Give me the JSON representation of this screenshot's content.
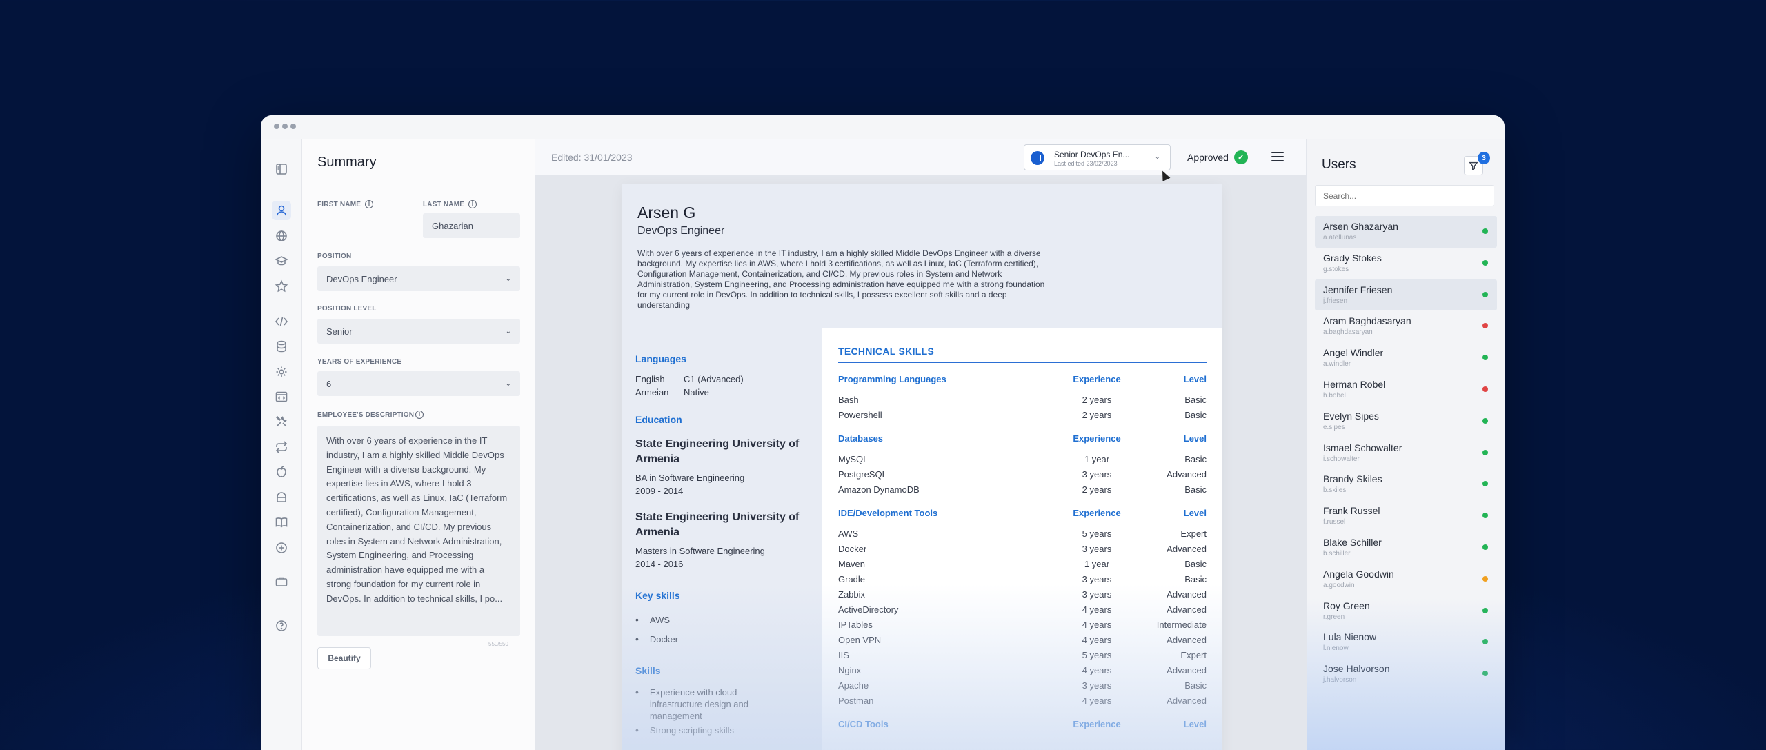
{
  "form": {
    "title": "Summary",
    "first_name_label": "FIRST NAME",
    "first_name_value": "",
    "last_name_label": "LAST NAME",
    "last_name_value": "Ghazarian",
    "position_label": "POSITION",
    "position_value": "DevOps Engineer",
    "level_label": "POSITION LEVEL",
    "level_value": "Senior",
    "years_label": "YEARS OF EXPERIENCE",
    "years_value": "6",
    "desc_label": "EMPLOYEE'S DESCRIPTION",
    "desc_value": "With over 6 years of experience in the IT industry, I am a highly skilled Middle DevOps Engineer with a diverse background. My expertise lies in AWS, where I hold 3 certifications, as well as Linux, IaC (Terraform certified), Configuration Management, Containerization, and CI/CD. My previous roles in System and Network Administration, System Engineering, and Processing administration have equipped me with a strong foundation for my current role in DevOps. In addition to technical skills, I po...",
    "char_count": "550/550",
    "beautify_label": "Beautify"
  },
  "toolbar": {
    "edited": "Edited: 31/01/2023",
    "template_title": "Senior DevOps En...",
    "template_sub": "Last edited 23/02/2023",
    "status": "Approved"
  },
  "cv": {
    "name": "Arsen G",
    "role": "DevOps Engineer",
    "summary": "With over 6 years of experience in the IT industry, I am a highly skilled Middle DevOps Engineer with a diverse background. My expertise lies in AWS, where I hold 3 certifications, as well as Linux, IaC (Terraform certified), Configuration Management, Containerization, and CI/CD. My previous roles in System and Network Administration, System Engineering, and Processing administration have equipped me with a strong foundation for my current role in DevOps. In addition to technical skills, I possess excellent soft skills and a deep understanding",
    "languages_title": "Languages",
    "languages": [
      {
        "name": "English",
        "level": "C1 (Advanced)"
      },
      {
        "name": "Armeian",
        "level": "Native"
      }
    ],
    "education_title": "Education",
    "education": [
      {
        "school": "State Engineering University of Armenia",
        "degree": "BA in Software Engineering",
        "years": "2009 - 2014"
      },
      {
        "school": "State Engineering University of Armenia",
        "degree": "Masters in Software Engineering",
        "years": "2014 - 2016"
      }
    ],
    "key_skills_title": "Key skills",
    "key_skills": [
      "AWS",
      "Docker"
    ],
    "skills_title": "Skills",
    "skills": [
      "Experience with cloud infrastructure design and management",
      "Strong scripting skills"
    ],
    "tech_title": "TECHNICAL SKILLS",
    "col_exp": "Experience",
    "col_level": "Level",
    "groups": [
      {
        "title": "Programming Languages",
        "rows": [
          {
            "name": "Bash",
            "exp": "2 years",
            "level": "Basic"
          },
          {
            "name": "Powershell",
            "exp": "2 years",
            "level": "Basic"
          }
        ]
      },
      {
        "title": "Databases",
        "rows": [
          {
            "name": "MySQL",
            "exp": "1 year",
            "level": "Basic"
          },
          {
            "name": "PostgreSQL",
            "exp": "3 years",
            "level": "Advanced"
          },
          {
            "name": "Amazon DynamoDB",
            "exp": "2 years",
            "level": "Basic"
          }
        ]
      },
      {
        "title": "IDE/Development Tools",
        "rows": [
          {
            "name": "AWS",
            "exp": "5 years",
            "level": "Expert"
          },
          {
            "name": "Docker",
            "exp": "3 years",
            "level": "Advanced"
          },
          {
            "name": "Maven",
            "exp": "1 year",
            "level": "Basic"
          },
          {
            "name": "Gradle",
            "exp": "3 years",
            "level": "Basic"
          },
          {
            "name": "Zabbix",
            "exp": "3 years",
            "level": "Advanced"
          },
          {
            "name": "ActiveDirectory",
            "exp": "4 years",
            "level": "Advanced"
          },
          {
            "name": "IPTables",
            "exp": "4 years",
            "level": "Intermediate"
          },
          {
            "name": "Open VPN",
            "exp": "4 years",
            "level": "Advanced"
          },
          {
            "name": "IIS",
            "exp": "5 years",
            "level": "Expert"
          },
          {
            "name": "Nginx",
            "exp": "4 years",
            "level": "Advanced"
          },
          {
            "name": "Apache",
            "exp": "3 years",
            "level": "Basic"
          },
          {
            "name": "Postman",
            "exp": "4 years",
            "level": "Advanced"
          }
        ]
      },
      {
        "title": "CI/CD Tools",
        "rows": []
      }
    ]
  },
  "users": {
    "title": "Users",
    "filter_count": "3",
    "search_placeholder": "Search...",
    "list": [
      {
        "name": "Arsen Ghazaryan",
        "login": "a.atellunas",
        "status": "#22b455"
      },
      {
        "name": "Grady Stokes",
        "login": "g.stokes",
        "status": "#22b455"
      },
      {
        "name": "Jennifer Friesen",
        "login": "j.friesen",
        "status": "#22b455"
      },
      {
        "name": "Aram Baghdasaryan",
        "login": "a.baghdasaryan",
        "status": "#e04444"
      },
      {
        "name": "Angel Windler",
        "login": "a.windler",
        "status": "#22b455"
      },
      {
        "name": "Herman Robel",
        "login": "h.bobel",
        "status": "#e04444"
      },
      {
        "name": "Evelyn Sipes",
        "login": "e.sipes",
        "status": "#22b455"
      },
      {
        "name": "Ismael Schowalter",
        "login": "i.schowalter",
        "status": "#22b455"
      },
      {
        "name": "Brandy Skiles",
        "login": "b.skiles",
        "status": "#22b455"
      },
      {
        "name": "Frank Russel",
        "login": "f.russel",
        "status": "#22b455"
      },
      {
        "name": "Blake Schiller",
        "login": "b.schiller",
        "status": "#22b455"
      },
      {
        "name": "Angela Goodwin",
        "login": "a.goodwin",
        "status": "#f0a020"
      },
      {
        "name": "Roy Green",
        "login": "r.green",
        "status": "#22b455"
      },
      {
        "name": "Lula Nienow",
        "login": "l.nienow",
        "status": "#22b455"
      },
      {
        "name": "Jose Halvorson",
        "login": "j.halvorson",
        "status": "#22b455"
      }
    ]
  },
  "rail_icons": [
    "sidebar-toggle-icon",
    "user-icon",
    "globe-icon",
    "graduation-cap-icon",
    "star-icon",
    "code-icon",
    "database-icon",
    "gear-icon",
    "browser-icon",
    "tools-icon",
    "repeat-icon",
    "apple-icon",
    "android-icon",
    "book-icon",
    "plus-circle-icon",
    "briefcase-icon",
    "help-icon"
  ]
}
